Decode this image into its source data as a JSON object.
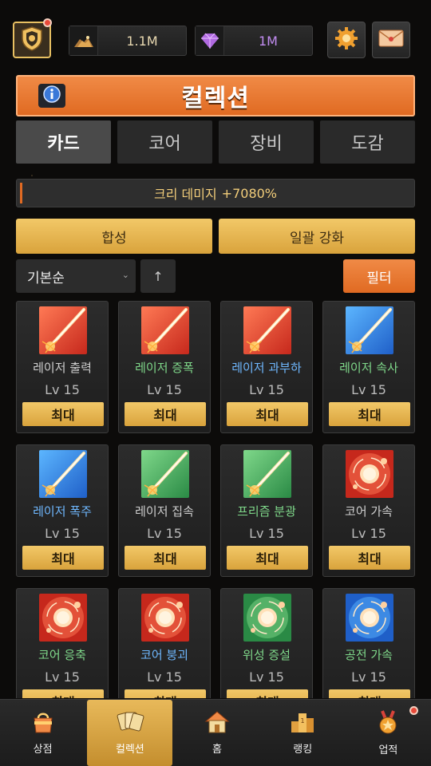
{
  "header": {
    "resources": [
      {
        "icon": "gold-pile-icon",
        "value": "1.1M",
        "color": "#e8d8b0"
      },
      {
        "icon": "gem-icon",
        "value": "1M",
        "color": "#c18cf0"
      }
    ]
  },
  "title": "컬렉션",
  "tabs": [
    {
      "label": "카드",
      "active": true
    },
    {
      "label": "코어",
      "active": false
    },
    {
      "label": "장비",
      "active": false
    },
    {
      "label": "도감",
      "active": false
    }
  ],
  "bonus": {
    "label": "크리 데미지",
    "value": "+7080%"
  },
  "actions": {
    "synthesize": "합성",
    "bulk_upgrade": "일괄 강화"
  },
  "sort": {
    "selected": "기본순",
    "direction": "↑"
  },
  "filter_label": "필터",
  "cards": [
    {
      "name": "레이저 출력",
      "lv": "Lv 15",
      "max": "최대",
      "art": "laser",
      "bg": "red",
      "name_color": "#cfcfcf"
    },
    {
      "name": "레이저 증폭",
      "lv": "Lv 15",
      "max": "최대",
      "art": "laser",
      "bg": "red",
      "name_color": "#7fd88a"
    },
    {
      "name": "레이저 과부하",
      "lv": "Lv 15",
      "max": "최대",
      "art": "laser",
      "bg": "red",
      "name_color": "#6fb8ff"
    },
    {
      "name": "레이저 속사",
      "lv": "Lv 15",
      "max": "최대",
      "art": "laser",
      "bg": "blue",
      "name_color": "#7fd88a"
    },
    {
      "name": "레이저 폭주",
      "lv": "Lv 15",
      "max": "최대",
      "art": "laser",
      "bg": "blue",
      "name_color": "#6fb8ff"
    },
    {
      "name": "레이저 집속",
      "lv": "Lv 15",
      "max": "최대",
      "art": "laser",
      "bg": "green",
      "name_color": "#cfcfcf"
    },
    {
      "name": "프리즘 분광",
      "lv": "Lv 15",
      "max": "최대",
      "art": "laser",
      "bg": "green",
      "name_color": "#7fd88a"
    },
    {
      "name": "코어 가속",
      "lv": "Lv 15",
      "max": "최대",
      "art": "core",
      "bg": "red",
      "name_color": "#cfcfcf"
    },
    {
      "name": "코어 응축",
      "lv": "Lv 15",
      "max": "최대",
      "art": "core",
      "bg": "red",
      "name_color": "#7fd88a"
    },
    {
      "name": "코어 붕괴",
      "lv": "Lv 15",
      "max": "최대",
      "art": "core",
      "bg": "red",
      "name_color": "#6fb8ff"
    },
    {
      "name": "위성 증설",
      "lv": "Lv 15",
      "max": "최대",
      "art": "core",
      "bg": "green",
      "name_color": "#7fd88a"
    },
    {
      "name": "공전 가속",
      "lv": "Lv 15",
      "max": "최대",
      "art": "core",
      "bg": "blue",
      "name_color": "#7fd88a"
    }
  ],
  "nav": [
    {
      "label": "상점",
      "icon": "shop-bag-icon",
      "active": false,
      "dot": false
    },
    {
      "label": "컬렉션",
      "icon": "cards-icon",
      "active": true,
      "dot": false
    },
    {
      "label": "홈",
      "icon": "home-icon",
      "active": false,
      "dot": false
    },
    {
      "label": "랭킹",
      "icon": "ranking-icon",
      "active": false,
      "dot": false
    },
    {
      "label": "업적",
      "icon": "medal-icon",
      "active": false,
      "dot": true
    }
  ]
}
